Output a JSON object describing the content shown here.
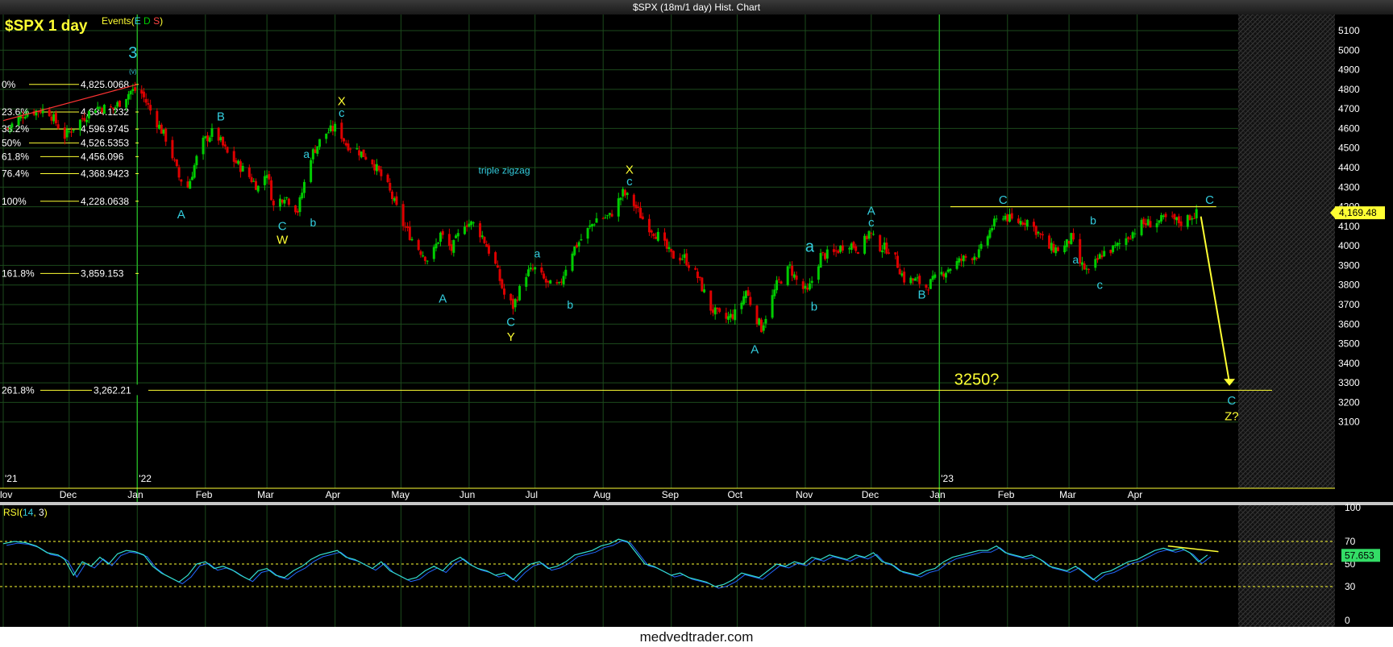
{
  "window": {
    "title": "$SPX (18m/1 day) Hist. Chart"
  },
  "header": {
    "symbol_label": "$SPX 1 day",
    "events_label": "Events(",
    "events_e": "E",
    "events_d": "D",
    "events_s": "S",
    "events_close": ")"
  },
  "footer": {
    "site": "medvedtrader.com"
  },
  "colors": {
    "background": "#000000",
    "up": "#00cc00",
    "down": "#dd0000",
    "grid": "#1c4a1c",
    "labels_cyan": "#33ccdd",
    "labels_yellow": "#ffff33",
    "axis_text": "#ffffff"
  },
  "chart_data": {
    "type": "candlestick",
    "ylim": [
      3000,
      5100
    ],
    "y_ticks": [
      "5,100",
      "5,000",
      "4,900",
      "4,800",
      "4,700",
      "4,600",
      "4,500",
      "4,400",
      "4,300",
      "4,200",
      "4,100",
      "4,000",
      "3,900",
      "3,800",
      "3,700",
      "3,600",
      "3,500",
      "3,400",
      "3,300",
      "3,200",
      "3,100"
    ],
    "y_tick_values": [
      5100,
      5000,
      4900,
      4800,
      4700,
      4600,
      4500,
      4400,
      4300,
      4200,
      4100,
      4000,
      3900,
      3800,
      3700,
      3600,
      3500,
      3400,
      3300,
      3200,
      3100
    ],
    "months": [
      {
        "label": "Nov",
        "day": 0
      },
      {
        "label": "Dec",
        "day": 30
      },
      {
        "label": "Jan",
        "day": 61
      },
      {
        "label": "Feb",
        "day": 92
      },
      {
        "label": "Mar",
        "day": 120
      },
      {
        "label": "Apr",
        "day": 151
      },
      {
        "label": "May",
        "day": 181
      },
      {
        "label": "Jun",
        "day": 212
      },
      {
        "label": "Jul",
        "day": 242
      },
      {
        "label": "Aug",
        "day": 273
      },
      {
        "label": "Sep",
        "day": 304
      },
      {
        "label": "Oct",
        "day": 334
      },
      {
        "label": "Nov",
        "day": 365
      },
      {
        "label": "Dec",
        "day": 395
      },
      {
        "label": "Jan",
        "day": 426
      },
      {
        "label": "Feb",
        "day": 457
      },
      {
        "label": "Mar",
        "day": 485
      },
      {
        "label": "Apr",
        "day": 516
      }
    ],
    "year_labels": [
      {
        "label": "'21",
        "day": 0
      },
      {
        "label": "'22",
        "day": 61
      },
      {
        "label": "'23",
        "day": 426
      }
    ],
    "year_lines_days": [
      61,
      426
    ],
    "last_price": "4,169.48",
    "price_path": [
      [
        2,
        4600
      ],
      [
        10,
        4680
      ],
      [
        20,
        4700
      ],
      [
        28,
        4560
      ],
      [
        35,
        4640
      ],
      [
        42,
        4710
      ],
      [
        50,
        4700
      ],
      [
        58,
        4790
      ],
      [
        62,
        4800
      ],
      [
        68,
        4670
      ],
      [
        75,
        4530
      ],
      [
        80,
        4350
      ],
      [
        84,
        4300
      ],
      [
        90,
        4520
      ],
      [
        96,
        4590
      ],
      [
        102,
        4470
      ],
      [
        110,
        4380
      ],
      [
        116,
        4300
      ],
      [
        120,
        4380
      ],
      [
        123,
        4200
      ],
      [
        128,
        4260
      ],
      [
        134,
        4180
      ],
      [
        140,
        4460
      ],
      [
        146,
        4570
      ],
      [
        152,
        4610
      ],
      [
        156,
        4520
      ],
      [
        160,
        4500
      ],
      [
        168,
        4430
      ],
      [
        175,
        4300
      ],
      [
        182,
        4110
      ],
      [
        188,
        4000
      ],
      [
        194,
        3920
      ],
      [
        199,
        4060
      ],
      [
        204,
        3980
      ],
      [
        210,
        4120
      ],
      [
        214,
        4110
      ],
      [
        218,
        4050
      ],
      [
        224,
        3900
      ],
      [
        228,
        3750
      ],
      [
        232,
        3690
      ],
      [
        238,
        3860
      ],
      [
        242,
        3880
      ],
      [
        248,
        3800
      ],
      [
        253,
        3790
      ],
      [
        258,
        3960
      ],
      [
        264,
        4050
      ],
      [
        270,
        4140
      ],
      [
        276,
        4150
      ],
      [
        282,
        4270
      ],
      [
        286,
        4230
      ],
      [
        292,
        4120
      ],
      [
        298,
        4050
      ],
      [
        304,
        3950
      ],
      [
        310,
        3940
      ],
      [
        316,
        3840
      ],
      [
        322,
        3680
      ],
      [
        328,
        3620
      ],
      [
        334,
        3660
      ],
      [
        338,
        3770
      ],
      [
        342,
        3650
      ],
      [
        345,
        3580
      ],
      [
        352,
        3800
      ],
      [
        358,
        3890
      ],
      [
        362,
        3800
      ],
      [
        366,
        3760
      ],
      [
        372,
        3950
      ],
      [
        378,
        3960
      ],
      [
        384,
        4020
      ],
      [
        390,
        3980
      ],
      [
        394,
        4070
      ],
      [
        398,
        4000
      ],
      [
        404,
        3980
      ],
      [
        410,
        3830
      ],
      [
        416,
        3820
      ],
      [
        420,
        3790
      ],
      [
        426,
        3850
      ],
      [
        432,
        3900
      ],
      [
        438,
        3940
      ],
      [
        444,
        3960
      ],
      [
        450,
        4100
      ],
      [
        455,
        4160
      ],
      [
        460,
        4120
      ],
      [
        466,
        4130
      ],
      [
        470,
        4080
      ],
      [
        476,
        3990
      ],
      [
        482,
        3980
      ],
      [
        486,
        4040
      ],
      [
        490,
        3910
      ],
      [
        494,
        3860
      ],
      [
        500,
        3960
      ],
      [
        506,
        3990
      ],
      [
        512,
        4050
      ],
      [
        518,
        4110
      ],
      [
        524,
        4120
      ],
      [
        530,
        4140
      ],
      [
        536,
        4120
      ],
      [
        540,
        4150
      ],
      [
        544,
        4169
      ]
    ],
    "fib_levels": [
      {
        "pct": "0%",
        "value": "4,825.0068",
        "v": 4825
      },
      {
        "pct": "23.6%",
        "value": "4,684.1232",
        "v": 4684
      },
      {
        "pct": "38.2%",
        "value": "4,596.9745",
        "v": 4597
      },
      {
        "pct": "50%",
        "value": "4,526.5353",
        "v": 4526
      },
      {
        "pct": "61.8%",
        "value": "4,456.096",
        "v": 4456
      },
      {
        "pct": "76.4%",
        "value": "4,368.9423",
        "v": 4369
      },
      {
        "pct": "100%",
        "value": "4,228.0638",
        "v": 4228
      },
      {
        "pct": "161.8%",
        "value": "3,859.153",
        "v": 3859
      },
      {
        "pct": "261.8%",
        "value": "3,262.21",
        "v": 3262
      }
    ],
    "wave_labels": [
      {
        "text": "3",
        "day": 59,
        "price": 4960,
        "color": "cyan",
        "size": 20
      },
      {
        "text": "(v)",
        "day": 59,
        "price": 4880,
        "color": "cyan",
        "size": 8
      },
      {
        "text": "A",
        "day": 81,
        "price": 4140,
        "color": "cyan",
        "size": 15
      },
      {
        "text": "B",
        "day": 99,
        "price": 4640,
        "color": "cyan",
        "size": 15
      },
      {
        "text": "C",
        "day": 127,
        "price": 4080,
        "color": "cyan",
        "size": 15
      },
      {
        "text": "W",
        "day": 127,
        "price": 4010,
        "color": "yellow",
        "size": 15
      },
      {
        "text": "a",
        "day": 138,
        "price": 4450,
        "color": "cyan",
        "size": 14
      },
      {
        "text": "b",
        "day": 141,
        "price": 4100,
        "color": "cyan",
        "size": 14
      },
      {
        "text": "X",
        "day": 154,
        "price": 4720,
        "color": "yellow",
        "size": 15
      },
      {
        "text": "c",
        "day": 154,
        "price": 4660,
        "color": "cyan",
        "size": 15
      },
      {
        "text": "triple zigzag",
        "day": 228,
        "price": 4370,
        "color": "cyan",
        "size": 12
      },
      {
        "text": "A",
        "day": 200,
        "price": 3710,
        "color": "cyan",
        "size": 15
      },
      {
        "text": "C",
        "day": 231,
        "price": 3590,
        "color": "cyan",
        "size": 15
      },
      {
        "text": "Y",
        "day": 231,
        "price": 3515,
        "color": "yellow",
        "size": 15
      },
      {
        "text": "a",
        "day": 243,
        "price": 3940,
        "color": "cyan",
        "size": 14
      },
      {
        "text": "b",
        "day": 258,
        "price": 3680,
        "color": "cyan",
        "size": 14
      },
      {
        "text": "X",
        "day": 285,
        "price": 4370,
        "color": "yellow",
        "size": 15
      },
      {
        "text": "c",
        "day": 285,
        "price": 4310,
        "color": "cyan",
        "size": 15
      },
      {
        "text": "a",
        "day": 367,
        "price": 3970,
        "color": "cyan",
        "size": 20
      },
      {
        "text": "b",
        "day": 369,
        "price": 3670,
        "color": "cyan",
        "size": 15
      },
      {
        "text": "A",
        "day": 342,
        "price": 3450,
        "color": "cyan",
        "size": 15
      },
      {
        "text": "A",
        "day": 395,
        "price": 4160,
        "color": "cyan",
        "size": 15
      },
      {
        "text": "c",
        "day": 395,
        "price": 4100,
        "color": "cyan",
        "size": 15
      },
      {
        "text": "B",
        "day": 418,
        "price": 3730,
        "color": "cyan",
        "size": 15
      },
      {
        "text": "C",
        "day": 455,
        "price": 4215,
        "color": "cyan",
        "size": 15
      },
      {
        "text": "a",
        "day": 488,
        "price": 3910,
        "color": "cyan",
        "size": 14
      },
      {
        "text": "b",
        "day": 496,
        "price": 4110,
        "color": "cyan",
        "size": 14
      },
      {
        "text": "c",
        "day": 499,
        "price": 3780,
        "color": "cyan",
        "size": 15
      },
      {
        "text": "C",
        "day": 549,
        "price": 4215,
        "color": "cyan",
        "size": 15
      },
      {
        "text": "3250?",
        "day": 443,
        "price": 3290,
        "color": "yellow",
        "size": 20
      },
      {
        "text": "C",
        "day": 559,
        "price": 3190,
        "color": "cyan",
        "size": 15
      },
      {
        "text": "Z?",
        "day": 559,
        "price": 3110,
        "color": "yellow",
        "size": 15
      }
    ],
    "rsi": {
      "label": "RSI(",
      "period": "14",
      "smooth": "3",
      "close": ")",
      "ylim": [
        0,
        100
      ],
      "ticks": [
        "100",
        "70",
        "50",
        "30",
        "0"
      ],
      "tick_values": [
        100,
        70,
        50,
        30,
        0
      ],
      "current": "57.653",
      "series": [
        [
          0,
          68
        ],
        [
          5,
          70
        ],
        [
          10,
          69
        ],
        [
          15,
          66
        ],
        [
          20,
          60
        ],
        [
          25,
          58
        ],
        [
          28,
          54
        ],
        [
          32,
          40
        ],
        [
          36,
          52
        ],
        [
          40,
          48
        ],
        [
          44,
          56
        ],
        [
          48,
          50
        ],
        [
          52,
          59
        ],
        [
          56,
          62
        ],
        [
          60,
          61
        ],
        [
          64,
          58
        ],
        [
          68,
          48
        ],
        [
          72,
          42
        ],
        [
          76,
          38
        ],
        [
          80,
          34
        ],
        [
          84,
          40
        ],
        [
          88,
          50
        ],
        [
          92,
          52
        ],
        [
          96,
          46
        ],
        [
          100,
          48
        ],
        [
          104,
          45
        ],
        [
          108,
          40
        ],
        [
          112,
          36
        ],
        [
          116,
          44
        ],
        [
          120,
          46
        ],
        [
          124,
          40
        ],
        [
          128,
          38
        ],
        [
          132,
          44
        ],
        [
          136,
          48
        ],
        [
          140,
          54
        ],
        [
          144,
          58
        ],
        [
          148,
          60
        ],
        [
          152,
          62
        ],
        [
          156,
          56
        ],
        [
          160,
          54
        ],
        [
          164,
          50
        ],
        [
          168,
          46
        ],
        [
          172,
          52
        ],
        [
          176,
          44
        ],
        [
          180,
          40
        ],
        [
          184,
          36
        ],
        [
          188,
          38
        ],
        [
          192,
          44
        ],
        [
          196,
          48
        ],
        [
          200,
          44
        ],
        [
          204,
          52
        ],
        [
          208,
          56
        ],
        [
          212,
          50
        ],
        [
          216,
          46
        ],
        [
          220,
          44
        ],
        [
          224,
          40
        ],
        [
          228,
          42
        ],
        [
          232,
          36
        ],
        [
          236,
          44
        ],
        [
          240,
          50
        ],
        [
          244,
          52
        ],
        [
          248,
          46
        ],
        [
          252,
          48
        ],
        [
          256,
          52
        ],
        [
          260,
          58
        ],
        [
          264,
          60
        ],
        [
          268,
          62
        ],
        [
          272,
          66
        ],
        [
          276,
          68
        ],
        [
          280,
          72
        ],
        [
          284,
          70
        ],
        [
          288,
          60
        ],
        [
          292,
          50
        ],
        [
          296,
          48
        ],
        [
          300,
          44
        ],
        [
          304,
          40
        ],
        [
          308,
          42
        ],
        [
          312,
          38
        ],
        [
          316,
          36
        ],
        [
          320,
          34
        ],
        [
          324,
          30
        ],
        [
          328,
          32
        ],
        [
          332,
          36
        ],
        [
          336,
          42
        ],
        [
          340,
          40
        ],
        [
          344,
          38
        ],
        [
          348,
          44
        ],
        [
          352,
          50
        ],
        [
          356,
          48
        ],
        [
          360,
          52
        ],
        [
          364,
          50
        ],
        [
          368,
          56
        ],
        [
          372,
          54
        ],
        [
          376,
          58
        ],
        [
          380,
          56
        ],
        [
          384,
          54
        ],
        [
          388,
          58
        ],
        [
          392,
          56
        ],
        [
          396,
          60
        ],
        [
          400,
          52
        ],
        [
          404,
          50
        ],
        [
          408,
          44
        ],
        [
          412,
          42
        ],
        [
          416,
          40
        ],
        [
          420,
          44
        ],
        [
          424,
          46
        ],
        [
          428,
          52
        ],
        [
          432,
          56
        ],
        [
          436,
          58
        ],
        [
          440,
          60
        ],
        [
          444,
          62
        ],
        [
          448,
          62
        ],
        [
          452,
          66
        ],
        [
          456,
          60
        ],
        [
          460,
          58
        ],
        [
          464,
          56
        ],
        [
          468,
          58
        ],
        [
          472,
          54
        ],
        [
          476,
          48
        ],
        [
          480,
          46
        ],
        [
          484,
          44
        ],
        [
          488,
          48
        ],
        [
          492,
          42
        ],
        [
          496,
          36
        ],
        [
          500,
          42
        ],
        [
          504,
          44
        ],
        [
          508,
          48
        ],
        [
          512,
          52
        ],
        [
          516,
          54
        ],
        [
          520,
          58
        ],
        [
          524,
          62
        ],
        [
          528,
          64
        ],
        [
          532,
          62
        ],
        [
          536,
          64
        ],
        [
          540,
          60
        ],
        [
          544,
          52
        ],
        [
          548,
          58
        ]
      ]
    }
  }
}
